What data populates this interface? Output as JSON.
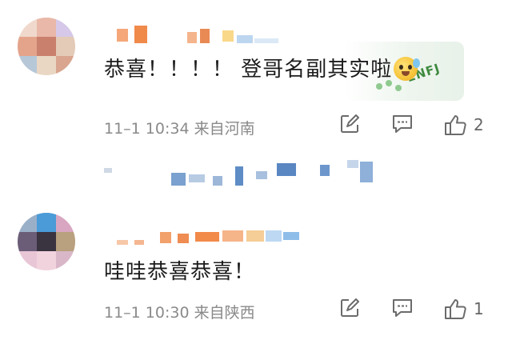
{
  "comments": [
    {
      "text": "恭喜！！！！ 登哥名副其实啦",
      "emoji": "crying-face-emoji",
      "sticker_text": "ENFJ",
      "meta": "11–1 10:34 来自河南",
      "likes": "2"
    },
    {
      "text": "哇哇恭喜恭喜！",
      "meta": "11–1 10:30 来自陕西",
      "likes": "1"
    }
  ],
  "colors": {
    "meta_gray": "#8a8a8a",
    "text": "#1c1c1c",
    "icon_gray": "#6b6b6b",
    "sticker_green": "#3f8a3f"
  }
}
